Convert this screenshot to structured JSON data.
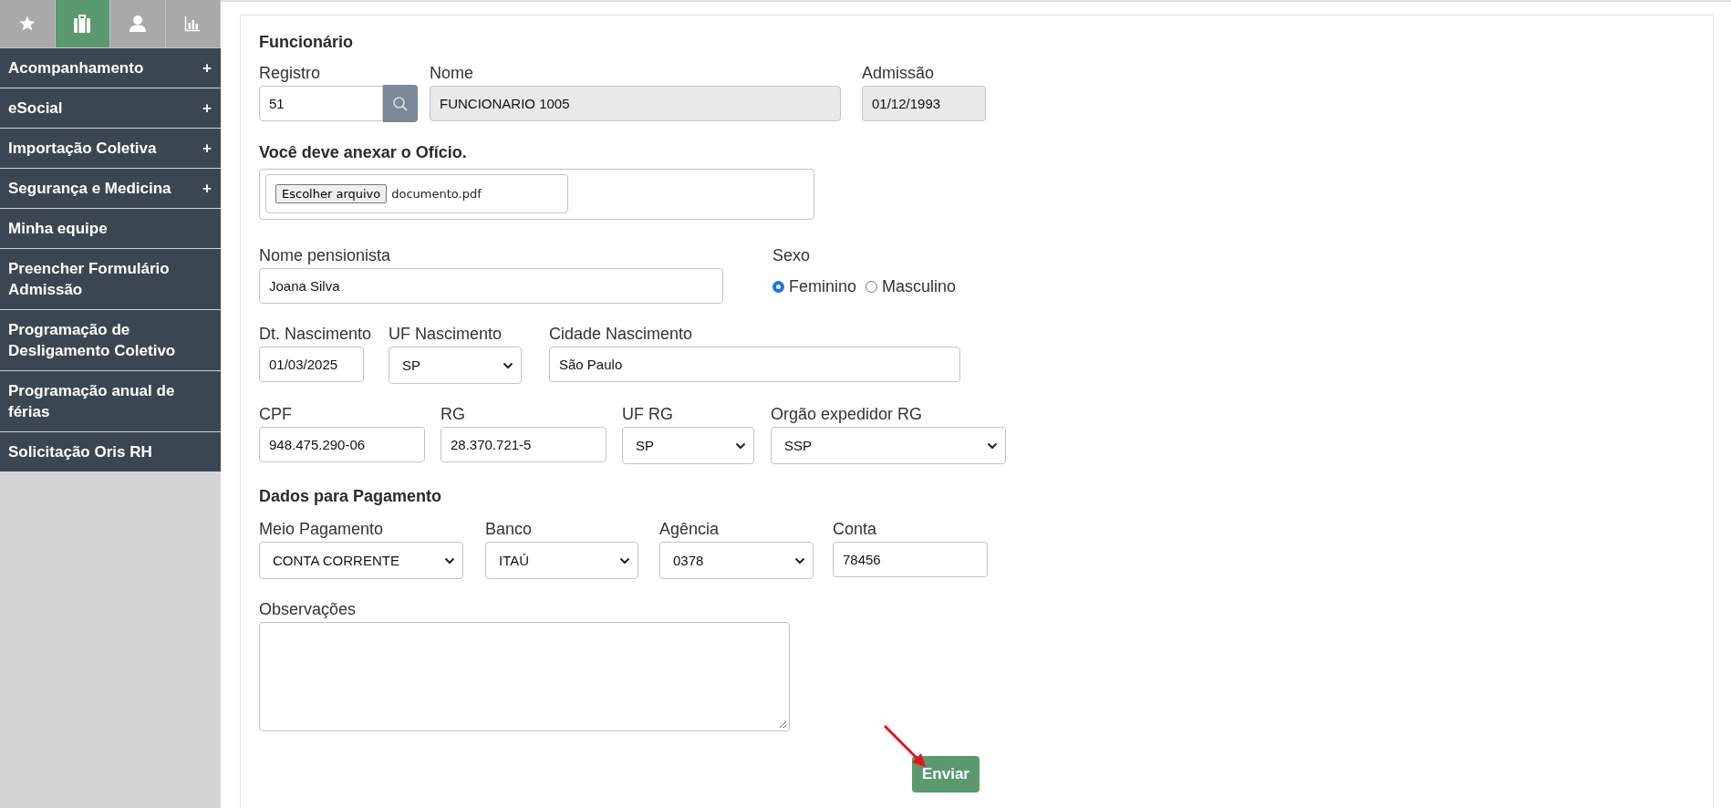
{
  "sidebar": {
    "tabs": [
      {
        "kind": "star",
        "selected": false
      },
      {
        "kind": "briefcase",
        "selected": true
      },
      {
        "kind": "person",
        "selected": false
      },
      {
        "kind": "chart",
        "selected": false
      }
    ],
    "menu": [
      {
        "label": "Acompanhamento",
        "toggle": "+"
      },
      {
        "label": "eSocial",
        "toggle": "+"
      },
      {
        "label": "Importação Coletiva",
        "toggle": "+"
      },
      {
        "label": "Segurança e Medicina",
        "toggle": "+"
      },
      {
        "label": "Minha equipe"
      },
      {
        "label": "Preencher Formulário Admissão"
      },
      {
        "label": "Programação de Desligamento Coletivo"
      },
      {
        "label": "Programação anual de férias"
      },
      {
        "label": "Solicitação Oris RH"
      }
    ]
  },
  "form": {
    "employee_heading": "Funcionário",
    "employee_fields": [
      {
        "label": "Registro",
        "value": "51",
        "kind": "lookup"
      },
      {
        "label": "Nome",
        "value": "FUNCIONARIO 1005",
        "kind": "readonly"
      },
      {
        "label": "Admissão",
        "value": "01/12/1993",
        "kind": "readonly"
      }
    ],
    "attachment": {
      "heading": "Você deve anexar o Ofício.",
      "button": "Escolher arquivo",
      "file_name": "documento.pdf"
    },
    "pensioner": {
      "label": "Nome pensionista",
      "value": "Joana Silva"
    },
    "sex": {
      "label": "Sexo",
      "options": [
        {
          "label": "Feminino",
          "selected": true
        },
        {
          "label": "Masculino",
          "selected": false
        }
      ]
    },
    "birth_fields": [
      {
        "label": "Dt. Nascimento",
        "value": "01/03/2025",
        "kind": "text"
      },
      {
        "label": "UF Nascimento",
        "value": "SP",
        "kind": "select"
      },
      {
        "label": "Cidade Nascimento",
        "value": "São Paulo",
        "kind": "text"
      }
    ],
    "document_fields": [
      {
        "label": "CPF",
        "value": "948.475.290-06",
        "kind": "text"
      },
      {
        "label": "RG",
        "value": "28.370.721-5",
        "kind": "text"
      },
      {
        "label": "UF RG",
        "value": "SP",
        "kind": "select"
      },
      {
        "label": "Orgão expedidor RG",
        "value": "SSP",
        "kind": "select"
      }
    ],
    "payment_heading": "Dados para Pagamento",
    "payment_fields": [
      {
        "label": "Meio Pagamento",
        "value": "CONTA CORRENTE",
        "kind": "select"
      },
      {
        "label": "Banco",
        "value": "ITAÚ",
        "kind": "select"
      },
      {
        "label": "Agência",
        "value": "0378",
        "kind": "select"
      },
      {
        "label": "Conta",
        "value": "78456",
        "kind": "text"
      }
    ],
    "notes": {
      "label": "Observações"
    },
    "submit": "Enviar"
  }
}
